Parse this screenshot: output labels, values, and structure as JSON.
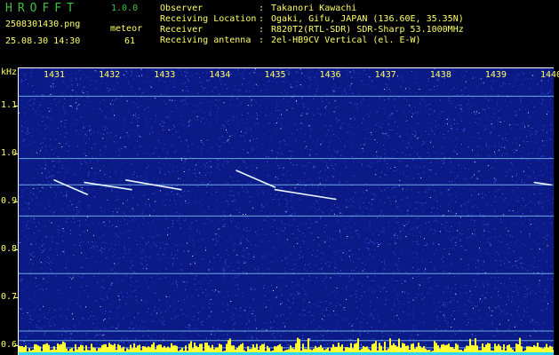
{
  "header": {
    "app_title": "HROFFT",
    "app_version": "1.0.0",
    "filename": "2508301430.png",
    "meteor_label": "meteor",
    "timestamp": "25.08.30 14:30",
    "meteor_count": "61"
  },
  "station": {
    "rows": [
      {
        "key": "Observer",
        "value": "Takanori Kawachi"
      },
      {
        "key": "Receiving Location",
        "value": "Ogaki, Gifu, JAPAN (136.60E, 35.35N)"
      },
      {
        "key": "Receiver",
        "value": "R820T2(RTL-SDR) SDR-Sharp 53.1000MHz"
      },
      {
        "key": "Receiving antenna",
        "value": "2el-HB9CV Vertical (el. E-W)"
      }
    ]
  },
  "chart_data": {
    "type": "heatmap",
    "ylabel": "kHz",
    "x_ticks": [
      "1431",
      "1432",
      "1433",
      "1434",
      "1435",
      "1436",
      "1437",
      "1438",
      "1439",
      "1440"
    ],
    "y_ticks": [
      "1.1",
      "1.0",
      "0.9",
      "0.8",
      "0.7",
      "0.6"
    ],
    "ylim": [
      0.58,
      1.18
    ],
    "horizontal_lines_khz": [
      1.12,
      0.99,
      0.935,
      0.87,
      0.75,
      0.63,
      0.61,
      0.595
    ],
    "meteor_traces": [
      {
        "x_start": 1431.0,
        "x_end": 1431.6,
        "y_start": 0.945,
        "y_end": 0.915
      },
      {
        "x_start": 1431.55,
        "x_end": 1432.4,
        "y_start": 0.94,
        "y_end": 0.925
      },
      {
        "x_start": 1432.3,
        "x_end": 1433.3,
        "y_start": 0.945,
        "y_end": 0.925
      },
      {
        "x_start": 1434.3,
        "x_end": 1435.0,
        "y_start": 0.965,
        "y_end": 0.93
      },
      {
        "x_start": 1435.0,
        "x_end": 1436.1,
        "y_start": 0.925,
        "y_end": 0.905
      },
      {
        "x_start": 1439.7,
        "x_end": 1440.0,
        "y_start": 0.94,
        "y_end": 0.935
      }
    ],
    "colors": {
      "background": "#0b1a86",
      "noise": "#3a6cff",
      "carrier": "#8fd6ff",
      "axis_text": "#ffff66",
      "title": "#3ec03e",
      "baseline_bars": "#ffff33"
    }
  }
}
